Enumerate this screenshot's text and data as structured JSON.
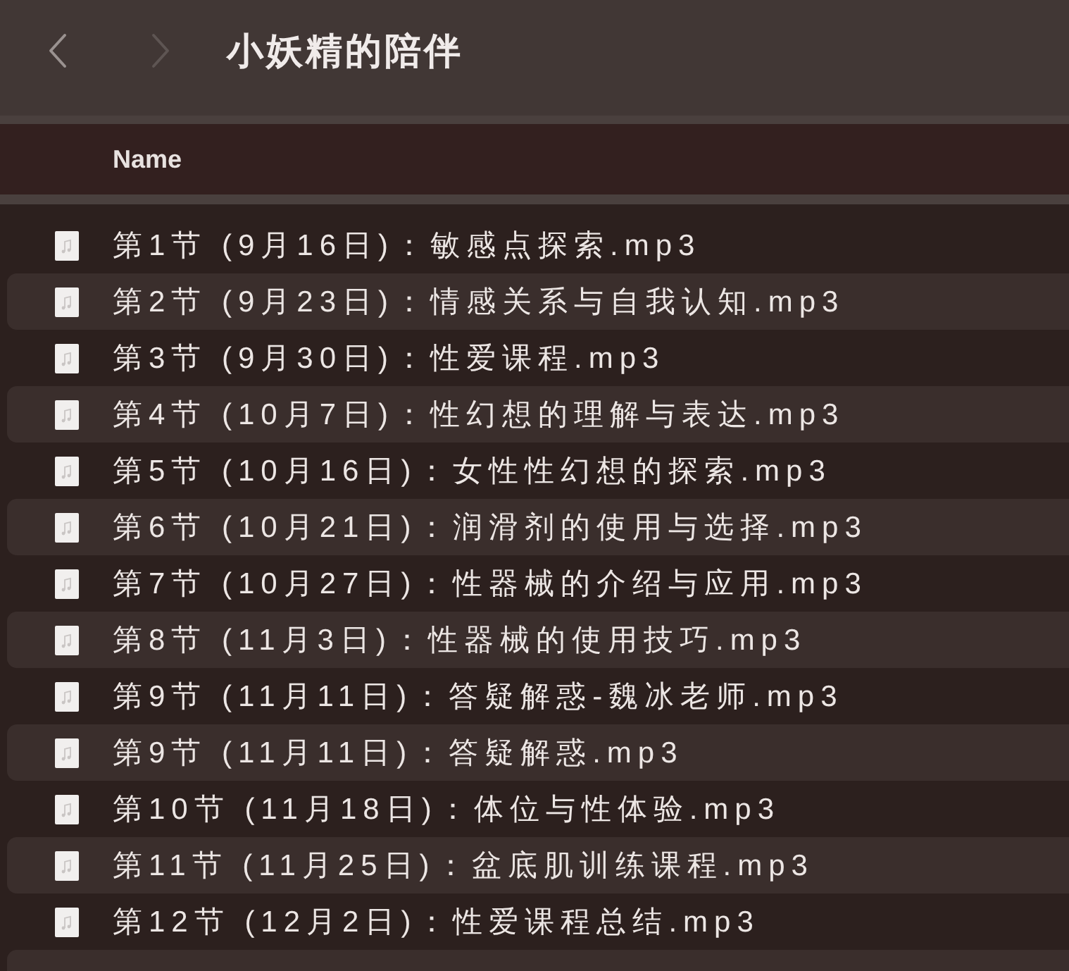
{
  "window": {
    "title": "小妖精的陪伴"
  },
  "toolbar": {
    "back": {
      "disabled": false
    },
    "forward": {
      "disabled": true
    }
  },
  "table": {
    "columns": [
      {
        "label": "Name"
      }
    ],
    "rows": [
      {
        "name": "第1节 (9月16日)：敏感点探索.mp3"
      },
      {
        "name": "第2节 (9月23日)：情感关系与自我认知.mp3"
      },
      {
        "name": "第3节 (9月30日)：性爱课程.mp3"
      },
      {
        "name": "第4节 (10月7日)：性幻想的理解与表达.mp3"
      },
      {
        "name": "第5节 (10月16日)：女性性幻想的探索.mp3"
      },
      {
        "name": "第6节 (10月21日)：润滑剂的使用与选择.mp3"
      },
      {
        "name": "第7节 (10月27日)：性器械的介绍与应用.mp3"
      },
      {
        "name": "第8节 (11月3日)：性器械的使用技巧.mp3"
      },
      {
        "name": "第9节 (11月11日)：答疑解惑-魏冰老师.mp3"
      },
      {
        "name": "第9节 (11月11日)：答疑解惑.mp3"
      },
      {
        "name": "第10节 (11月18日)：体位与性体验.mp3"
      },
      {
        "name": "第11节 (11月25日)：盆底肌训练课程.mp3"
      },
      {
        "name": "第12节 (12月2日)：性爱课程总结.mp3"
      }
    ]
  }
}
